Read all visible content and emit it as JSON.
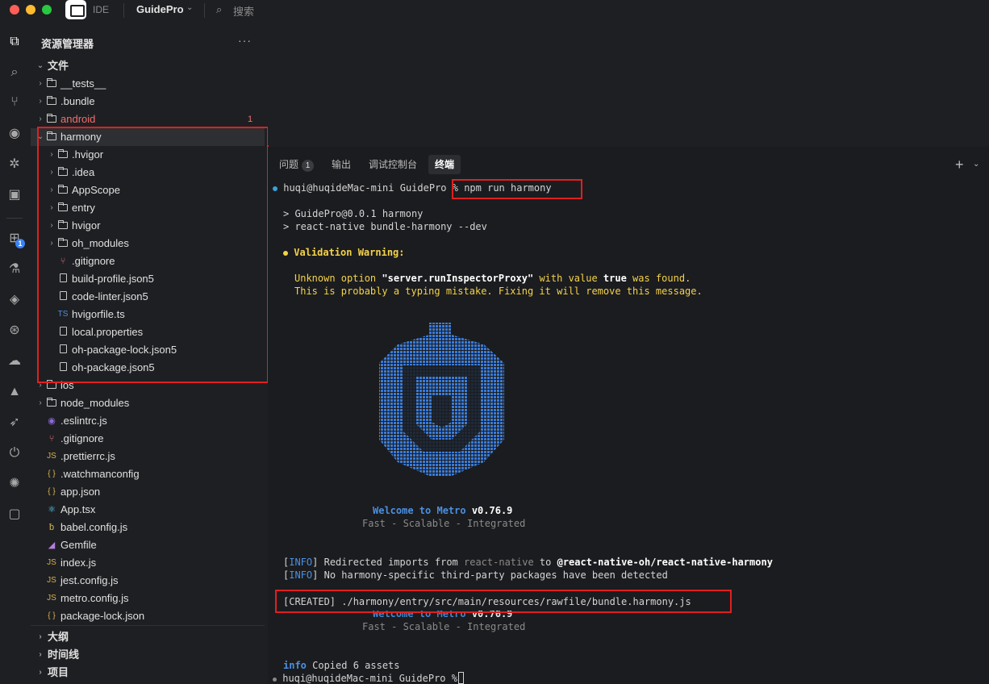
{
  "titlebar": {
    "ide_label": "IDE",
    "project": "GuidePro",
    "search_label": "搜索"
  },
  "activitybar": {
    "extensions_badge": "1"
  },
  "sidebar": {
    "title": "资源管理器",
    "more": "···",
    "section_files": "文件",
    "android_error_count": "1",
    "items": [
      "__tests__",
      ".bundle",
      "android",
      "harmony",
      ".hvigor",
      ".idea",
      "AppScope",
      "entry",
      "hvigor",
      "oh_modules",
      ".gitignore",
      "build-profile.json5",
      "code-linter.json5",
      "hvigorfile.ts",
      "local.properties",
      "oh-package-lock.json5",
      "oh-package.json5",
      "ios",
      "node_modules",
      ".eslintrc.js",
      ".gitignore",
      ".prettierrc.js",
      ".watchmanconfig",
      "app.json",
      "App.tsx",
      "babel.config.js",
      "Gemfile",
      "index.js",
      "jest.config.js",
      "metro.config.js",
      "package-lock.json"
    ],
    "section_outline": "大纲",
    "section_timeline": "时间线",
    "section_project": "项目"
  },
  "panel": {
    "tabs": [
      "问题",
      "输出",
      "调试控制台",
      "终端"
    ],
    "problems_badge": "1",
    "active_tab": "终端"
  },
  "terminal": {
    "prompt": "huqi@huqideMac-mini GuidePro % ",
    "command": "npm run harmony",
    "script_line1": "> GuidePro@0.0.1 harmony",
    "script_line2": "> react-native bundle-harmony --dev",
    "warning_title": "Validation Warning:",
    "warning_pre": "Unknown option ",
    "warning_option": "\"server.runInspectorProxy\"",
    "warning_mid": " with value ",
    "warning_value": "true",
    "warning_post": " was found.",
    "warning_line2": "This is probably a typing mistake. Fixing it will remove this message.",
    "welcome_a": "Welcome to Metro",
    "welcome_version": "v0.76.9",
    "tagline": "Fast - Scalable - Integrated",
    "info_tag": "INFO",
    "info1_pre": " Redirected imports from ",
    "info1_from": "react-native",
    "info1_mid": " to ",
    "info1_to": "@react-native-oh/react-native-harmony",
    "info2_text": " No harmony-specific third-party packages have been detected",
    "created_line": "[CREATED] ./harmony/entry/src/main/resources/rawfile/bundle.harmony.js",
    "info_label": "info",
    "copied": " Copied 6 assets"
  },
  "colors": {
    "highlight": "#e02020",
    "metro_blue": "#4a90e2",
    "warning_yellow": "#f4d24a"
  }
}
